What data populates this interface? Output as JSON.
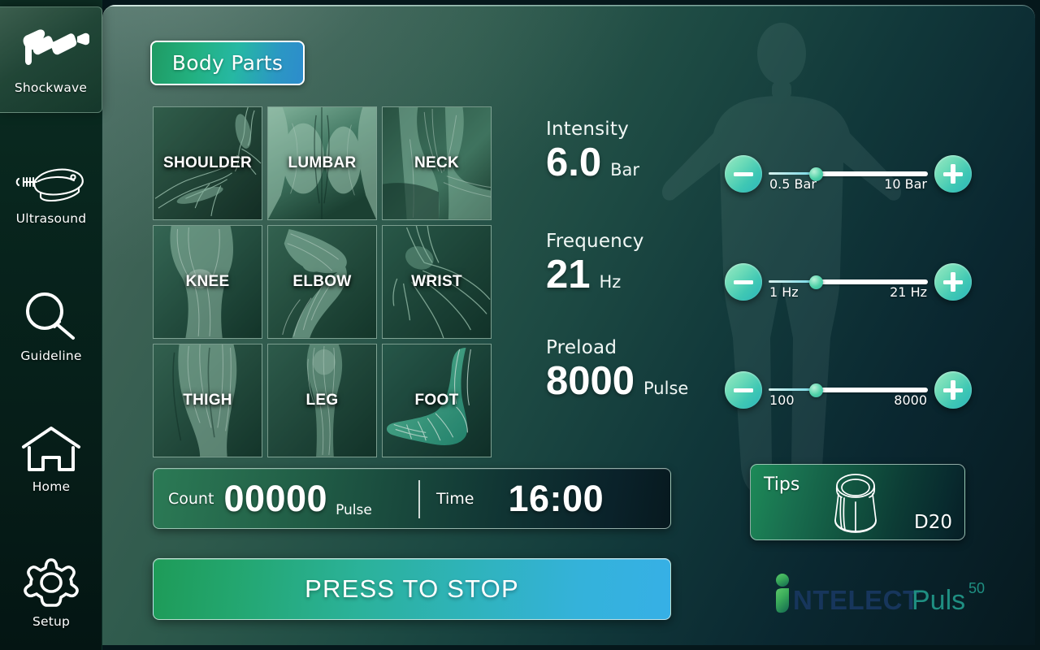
{
  "sidebar": {
    "items": [
      {
        "label": "Shockwave",
        "icon": "shockwave-handpiece-icon",
        "active": true
      },
      {
        "label": "Ultrasound",
        "icon": "ultrasound-probe-icon",
        "active": false
      },
      {
        "label": "Guideline",
        "icon": "magnifier-icon",
        "active": false
      },
      {
        "label": "Home",
        "icon": "home-icon",
        "active": false
      },
      {
        "label": "Setup",
        "icon": "gear-icon",
        "active": false
      }
    ]
  },
  "tabs": {
    "body_parts_label": "Body Parts"
  },
  "body_parts": [
    {
      "name": "SHOULDER"
    },
    {
      "name": "LUMBAR"
    },
    {
      "name": "NECK"
    },
    {
      "name": "KNEE"
    },
    {
      "name": "ELBOW"
    },
    {
      "name": "WRIST"
    },
    {
      "name": "THIGH"
    },
    {
      "name": "LEG"
    },
    {
      "name": "FOOT"
    }
  ],
  "parameters": [
    {
      "label": "Intensity",
      "value": "6.0",
      "unit": "Bar",
      "slider_min_label": "0.5 Bar",
      "slider_max_label": "10 Bar",
      "slider_percent": 30,
      "minus_icon": "minus-icon",
      "plus_icon": "plus-icon"
    },
    {
      "label": "Frequency",
      "value": "21",
      "unit": "Hz",
      "slider_min_label": "1 Hz",
      "slider_max_label": "21 Hz",
      "slider_percent": 30,
      "minus_icon": "minus-icon",
      "plus_icon": "plus-icon"
    },
    {
      "label": "Preload",
      "value": "8000",
      "unit": "Pulse",
      "slider_min_label": "100",
      "slider_max_label": "8000",
      "slider_percent": 30,
      "minus_icon": "minus-icon",
      "plus_icon": "plus-icon"
    }
  ],
  "counter": {
    "count_label": "Count",
    "count_value": "00000",
    "count_unit": "Pulse",
    "time_label": "Time",
    "time_value": "16:00"
  },
  "action": {
    "stop_label": "PRESS TO STOP"
  },
  "tips": {
    "label": "Tips",
    "code": "D20",
    "icon": "transmitter-tip-icon"
  },
  "logo": {
    "mark": "i",
    "brand": "NTELECT",
    "product": "Puls",
    "superscript": "50"
  },
  "colors": {
    "accent_green": "#2bb47f",
    "accent_teal": "#2fb3bc",
    "accent_blue": "#36b0e6",
    "panel_dark": "#06191f",
    "logo_navy": "#17365c",
    "logo_teal": "#1f8f82",
    "logo_green": "#3eb54a"
  }
}
